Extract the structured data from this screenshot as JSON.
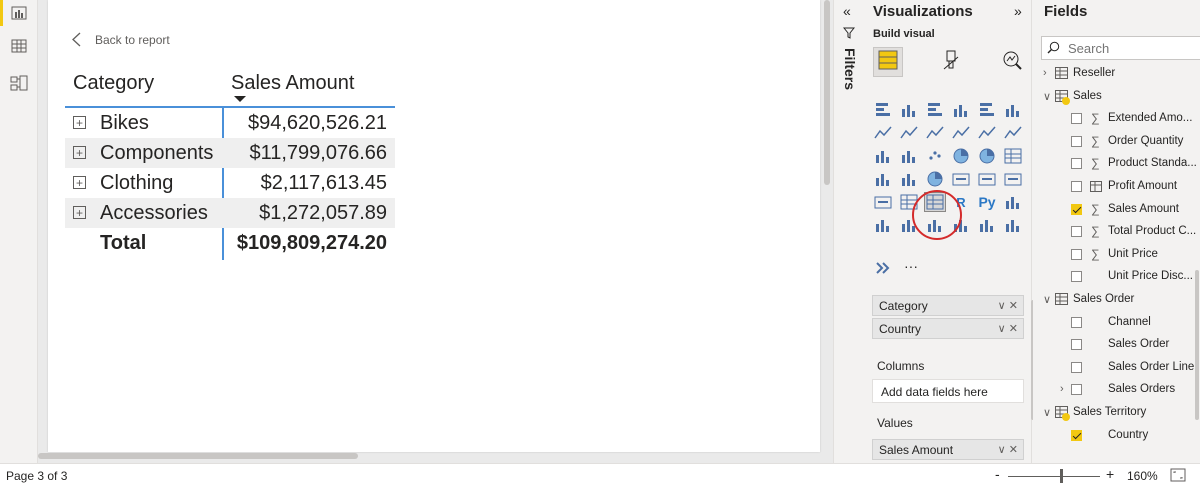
{
  "canvas": {
    "back_link": "Back to report",
    "matrix": {
      "headers": {
        "category": "Category",
        "amount": "Sales Amount"
      },
      "rows": [
        {
          "category": "Bikes",
          "amount": "$94,620,526.21"
        },
        {
          "category": "Components",
          "amount": "$11,799,076.66"
        },
        {
          "category": "Clothing",
          "amount": "$2,117,613.45"
        },
        {
          "category": "Accessories",
          "amount": "$1,272,057.89"
        }
      ],
      "total": {
        "label": "Total",
        "amount": "$109,809,274.20"
      },
      "expand_symbol": "+"
    }
  },
  "filters": {
    "label": "Filters",
    "expand_icon": "«"
  },
  "visualizations": {
    "title": "Visualizations",
    "collapse_icon": "»",
    "build_visual": "Build visual",
    "more": "···",
    "selected_visual": "matrix",
    "wells": {
      "rows_fields": [
        "Category",
        "Country"
      ],
      "columns_label": "Columns",
      "columns_placeholder": "Add data fields here",
      "values_label": "Values",
      "values_fields": [
        "Sales Amount"
      ],
      "field_controls": "∨ ✕"
    }
  },
  "fields": {
    "title": "Fields",
    "search_placeholder": "Search",
    "items": [
      {
        "label": "Reseller",
        "type": "table",
        "expanded": false
      },
      {
        "label": "Sales",
        "type": "table",
        "expanded": true
      },
      {
        "label": "Extended Amo...",
        "type": "measure-sum",
        "checked": false
      },
      {
        "label": "Order Quantity",
        "type": "measure-sum",
        "checked": false
      },
      {
        "label": "Product Standa...",
        "type": "measure-sum",
        "checked": false
      },
      {
        "label": "Profit Amount",
        "type": "calc-table",
        "checked": false
      },
      {
        "label": "Sales Amount",
        "type": "measure-sum",
        "checked": true
      },
      {
        "label": "Total Product C...",
        "type": "measure-sum",
        "checked": false
      },
      {
        "label": "Unit Price",
        "type": "measure-sum",
        "checked": false
      },
      {
        "label": "Unit Price Disc...",
        "type": "field",
        "checked": false
      },
      {
        "label": "Sales Order",
        "type": "table",
        "expanded": true
      },
      {
        "label": "Channel",
        "type": "field",
        "checked": false
      },
      {
        "label": "Sales Order",
        "type": "field",
        "checked": false
      },
      {
        "label": "Sales Order Line",
        "type": "field",
        "checked": false
      },
      {
        "label": "Sales Orders",
        "type": "hierarchy",
        "checked": false
      },
      {
        "label": "Sales Territory",
        "type": "table",
        "expanded": true
      },
      {
        "label": "Country",
        "type": "field",
        "checked": true
      }
    ]
  },
  "status": {
    "page": "Page 3 of 3",
    "zoom": "160%",
    "zoom_minus": "-",
    "zoom_plus": "+"
  },
  "colors": {
    "accent": "#f2c811",
    "highlight_circle": "#d42b2b",
    "table_rule": "#4a90d9"
  }
}
